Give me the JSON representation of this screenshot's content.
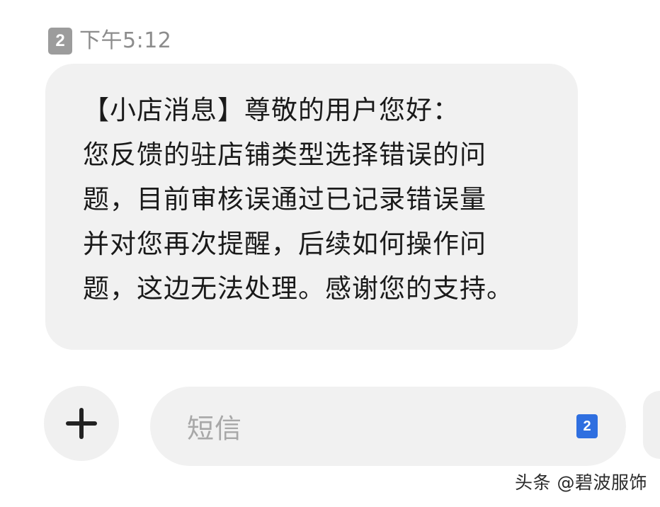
{
  "message": {
    "sim_slot": "2",
    "time": "下午5:12",
    "lines": [
      "【小店消息】尊敬的用户您好：",
      "您反馈的驻店铺类型选择错误的问",
      "题，目前审核误通过已记录错误量",
      "并对您再次提醒，后续如何操作问",
      "题，这边无法处理。感谢您的支持。"
    ]
  },
  "composer": {
    "placeholder": "短信",
    "sim_slot": "2",
    "attach_icon": "plus-icon"
  },
  "watermark": "头条 @碧波服饰",
  "colors": {
    "bubble": "#f1f1f1",
    "sim_badge_active": "#2f6fe0",
    "sim_badge_inactive": "#9c9c9c"
  }
}
